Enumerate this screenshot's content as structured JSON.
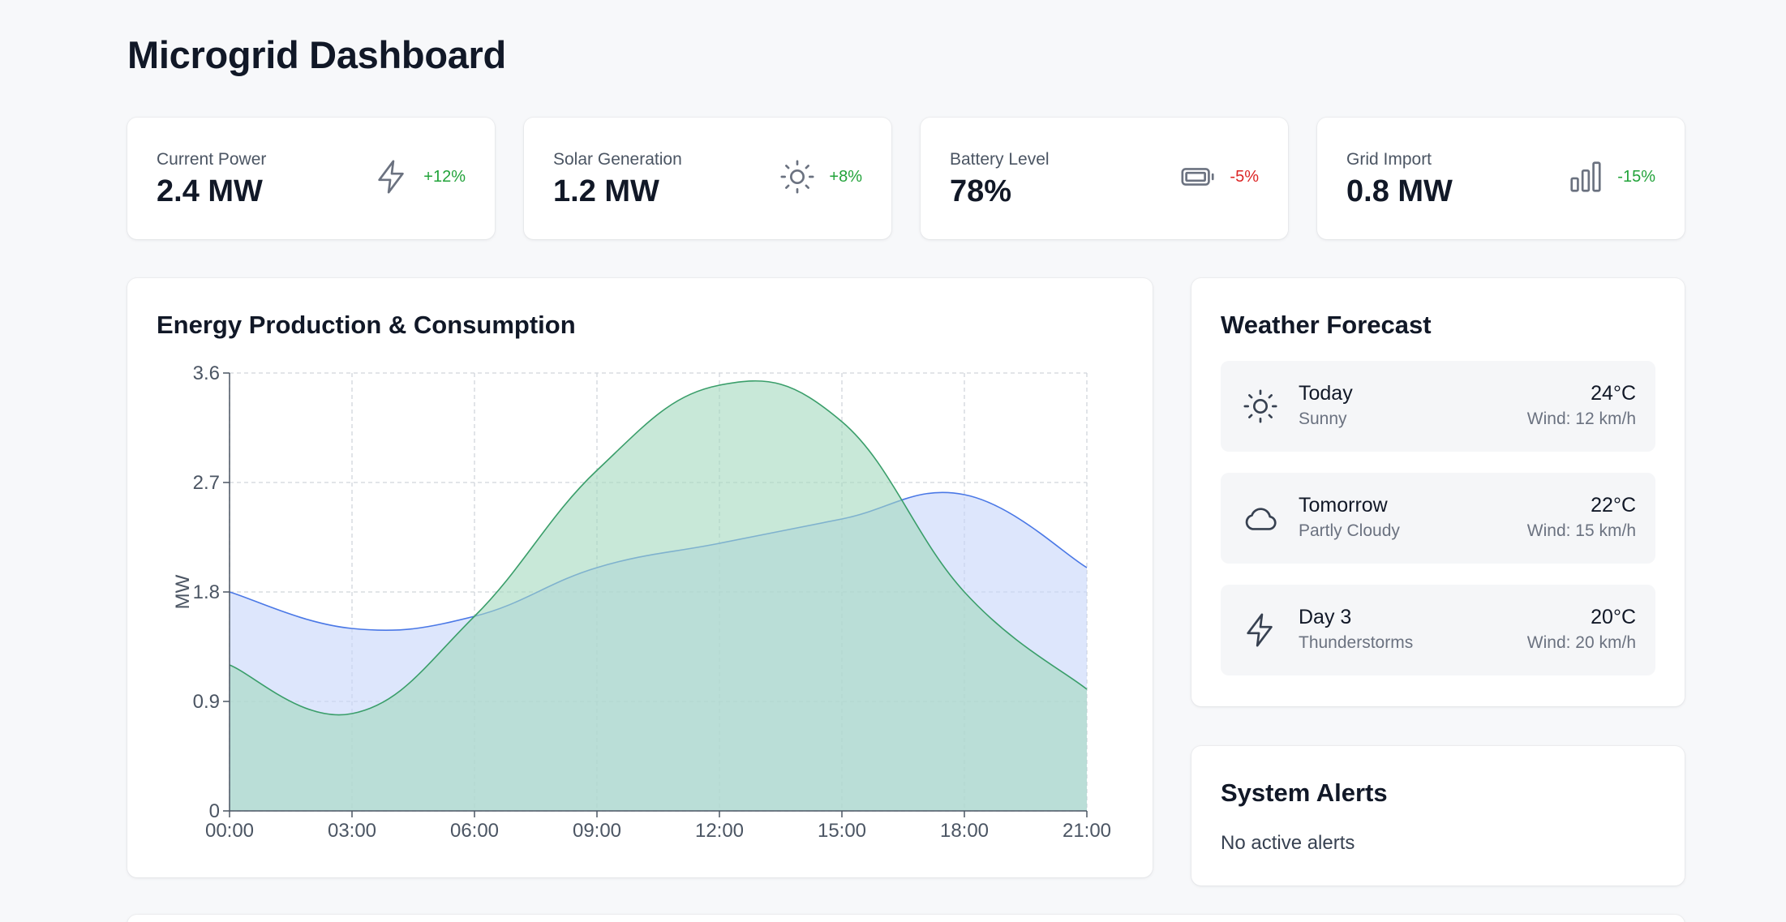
{
  "page": {
    "title": "Microgrid Dashboard"
  },
  "stats": [
    {
      "label": "Current Power",
      "value": "2.4 MW",
      "change": "+12%",
      "trend": "positive",
      "icon": "lightning-icon"
    },
    {
      "label": "Solar Generation",
      "value": "1.2 MW",
      "change": "+8%",
      "trend": "positive",
      "icon": "sun-icon"
    },
    {
      "label": "Battery Level",
      "value": "78%",
      "change": "-5%",
      "trend": "negative",
      "icon": "battery-icon"
    },
    {
      "label": "Grid Import",
      "value": "0.8 MW",
      "change": "-15%",
      "trend": "positive",
      "icon": "bar-chart-icon"
    }
  ],
  "chart": {
    "title": "Energy Production & Consumption"
  },
  "chart_data": {
    "type": "area",
    "title": "Energy Production & Consumption",
    "xlabel": "",
    "ylabel": "MW",
    "categories": [
      "00:00",
      "03:00",
      "06:00",
      "09:00",
      "12:00",
      "15:00",
      "18:00",
      "21:00"
    ],
    "ylim": [
      0,
      3.6
    ],
    "yticks": [
      "0",
      "0.9",
      "1.8",
      "2.7",
      "3.6"
    ],
    "grid": true,
    "series": [
      {
        "values": [
          1.8,
          1.5,
          1.6,
          2.0,
          2.2,
          2.4,
          2.6,
          2.0
        ],
        "color": "#4a78e6",
        "fill": "#c7d5fa"
      },
      {
        "values": [
          1.2,
          0.8,
          1.6,
          2.8,
          3.5,
          3.2,
          1.8,
          1.0
        ],
        "color": "#3a9e6a",
        "fill": "#a4d8be"
      }
    ]
  },
  "weather": {
    "title": "Weather Forecast",
    "items": [
      {
        "day": "Today",
        "condition": "Sunny",
        "temp": "24°C",
        "wind": "Wind: 12 km/h",
        "icon": "sun-icon"
      },
      {
        "day": "Tomorrow",
        "condition": "Partly Cloudy",
        "temp": "22°C",
        "wind": "Wind: 15 km/h",
        "icon": "cloud-icon"
      },
      {
        "day": "Day 3",
        "condition": "Thunderstorms",
        "temp": "20°C",
        "wind": "Wind: 20 km/h",
        "icon": "lightning-icon"
      }
    ]
  },
  "alerts": {
    "title": "System Alerts",
    "message": "No active alerts"
  },
  "colors": {
    "positive": "#22a33a",
    "negative": "#dc2626",
    "icon": "#6b7280"
  }
}
